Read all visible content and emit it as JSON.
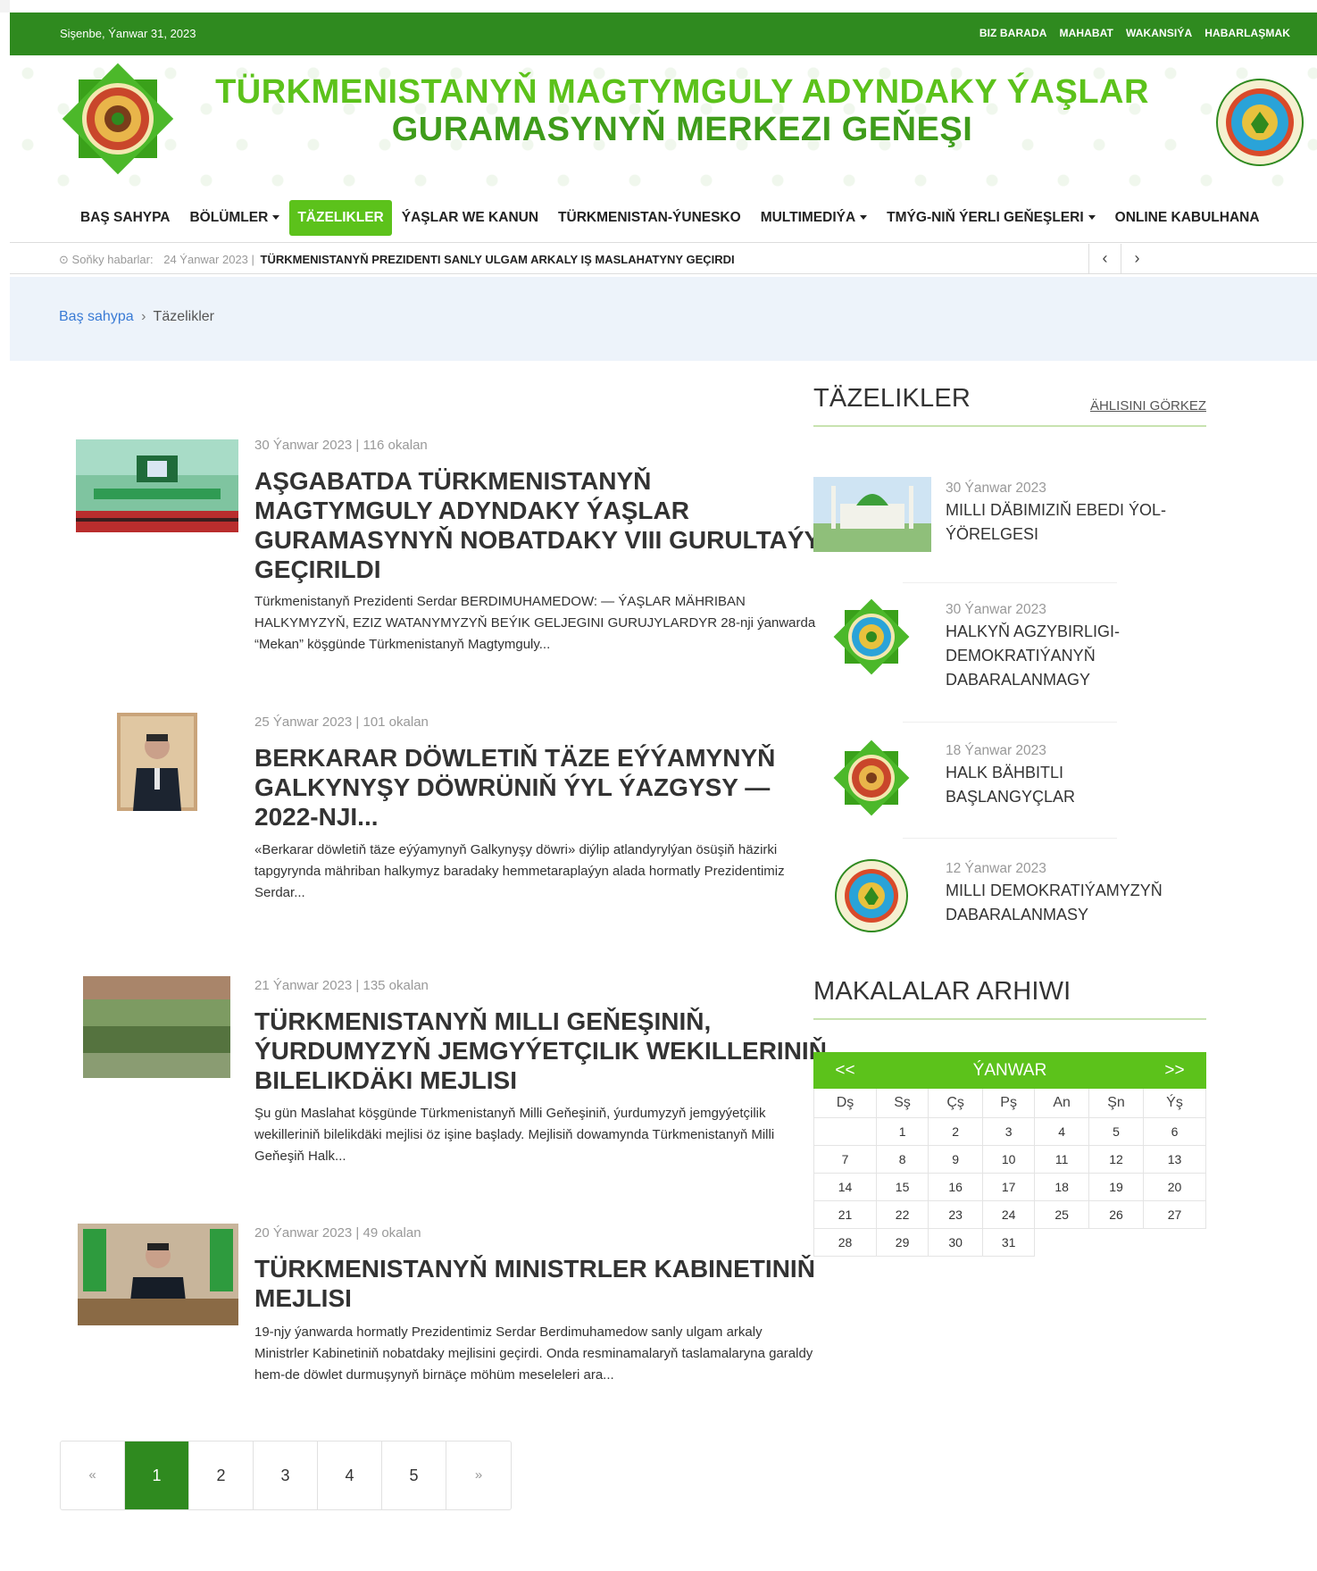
{
  "topbar": {
    "date": "Sişenbe, Ýanwar 31, 2023",
    "links": [
      "BIZ BARADA",
      "MAHABAT",
      "WAKANSIÝA",
      "HABARLAŞMAK"
    ]
  },
  "header": {
    "title_line1": "TÜRKMENISTANYŇ MAGTYMGULY ADYNDAKY ÝAŞLAR",
    "title_line2": "GURAMASYNYŇ MERKEZI GEŇEŞI"
  },
  "nav": {
    "items": [
      "BAŞ SAHYPA",
      "BÖLÜMLER",
      "TÄZELIKLER",
      "ÝAŞLAR WE KANUN",
      "TÜRKMENISTAN-ÝUNESKO",
      "MULTIMEDIÝA",
      "TMÝG-NIŇ ÝERLI GEŇEŞLERI",
      "ONLINE KABULHANA"
    ],
    "active": "TÄZELIKLER"
  },
  "ticker": {
    "label": "Soňky habarlar:",
    "date": "24 Ýanwar 2023 |",
    "headline": "TÜRKMENISTANYŇ PREZIDENTI SANLY ULGAM ARKALY IŞ MASLAHATYNY GEÇIRDI",
    "prev": "‹",
    "next": "›"
  },
  "breadcrumb": {
    "home": "Baş sahypa",
    "sep": "›",
    "current": "Täzelikler"
  },
  "articles": [
    {
      "meta": "30 Ýanwar 2023 | 116 okalan",
      "title": "AŞGABATDA TÜRKMENISTANYŇ MAGTYMGULY ADYNDAKY ÝAŞLAR GURAMASYNYŇ NOBATDAKY VIII GURULTAÝY GEÇIRILDI",
      "excerpt": "Türkmenistanyň Prezidenti Serdar BERDIMUHAMEDOW: — ÝAŞLAR MÄHRIBAN HALKYMYZYŇ, EZIZ WATANYMYZYŇ BEÝIK GELJEGINI GURUJYLARDYR   28-nji ýanwarda “Mekan” köşgünde Türkmenistanyň Magtymguly..."
    },
    {
      "meta": "25 Ýanwar 2023 | 101 okalan",
      "title": "BERKARAR DÖWLETIŇ TÄZE EÝÝAMYNYŇ GALKYNYŞY DÖWRÜNIŇ ÝYL ÝAZGYSY — 2022-NJI...",
      "excerpt": "«Berkarar döwletiň täze eýýamynyň Galkynyşy döwri» diýlip atlandyrylýan ösüşiň häzirki tapgyrynda mähriban halkymyz baradaky hemmetaraplaýyn alada hormatly Prezidentimiz Serdar..."
    },
    {
      "meta": "21 Ýanwar 2023 | 135 okalan",
      "title": "TÜRKMENISTANYŇ MILLI GEŇEŞINIŇ, ÝURDUMYZYŇ JEMGYÝETÇILIK WEKILLERINIŇ BILELIKDÄKI MEJLISI",
      "excerpt": "Şu gün Maslahat köşgünde Türkmenistanyň Milli Geňeşiniň, ýurdumyzyň jemgyýetçilik wekilleriniň bilelikdäki mejlisi öz işine başlady. Mejlisiň dowamynda Türkmenistanyň Milli Geňeşiň Halk..."
    },
    {
      "meta": "20 Ýanwar 2023 | 49 okalan",
      "title": "TÜRKMENISTANYŇ MINISTRLER KABINETINIŇ MEJLISI",
      "excerpt": "19-njy ýanwarda hormatly Prezidentimiz Serdar Berdimuhamedow sanly ulgam arkaly Ministrler Kabinetiniň nobatdaky mejlisini geçirdi. Onda resminamalaryň taslamalaryna garaldy hem-de döwlet durmuşynyň birnäçe möhüm meseleleri ara..."
    }
  ],
  "sidebar": {
    "news_heading": "TÄZELIKLER",
    "show_all": "ÄHLISINI GÖRKEZ",
    "news": [
      {
        "date": "30 Ýanwar 2023",
        "title": "MILLI DÄBIMIZIŇ EBEDI ÝOL-ÝÖRELGESI"
      },
      {
        "date": "30 Ýanwar 2023",
        "title": "HALKYŇ AGZYBIRLIGI-DEMOKRATIÝANYŇ DABARALANMAGY"
      },
      {
        "date": "18 Ýanwar 2023",
        "title": "HALK BÄHBITLI BAŞLANGYÇLAR"
      },
      {
        "date": "12 Ýanwar 2023",
        "title": "MILLI DEMOKRATIÝAMYZYŇ DABARALANMASY"
      }
    ],
    "archive_heading": "MAKALALAR ARHIWI",
    "calendar": {
      "prev": "<<",
      "month": "ÝANWAR",
      "next": ">>",
      "weekdays": [
        "Dş",
        "Sş",
        "Çş",
        "Pş",
        "An",
        "Şn",
        "Ýş"
      ],
      "weeks": [
        [
          "",
          "1",
          "2",
          "3",
          "4",
          "5",
          "6"
        ],
        [
          "7",
          "8",
          "9",
          "10",
          "11",
          "12",
          "13"
        ],
        [
          "14",
          "15",
          "16",
          "17",
          "18",
          "19",
          "20"
        ],
        [
          "21",
          "22",
          "23",
          "24",
          "25",
          "26",
          "27"
        ],
        [
          "28",
          "29",
          "30",
          "31",
          "",
          "",
          ""
        ]
      ]
    }
  },
  "pagination": {
    "prev": "«",
    "pages": [
      "1",
      "2",
      "3",
      "4",
      "5"
    ],
    "current": "1",
    "next": "»"
  },
  "colors": {
    "brand_green": "#2f8a1f",
    "accent_green": "#5cc21b",
    "title_green": "#5cc21b"
  }
}
